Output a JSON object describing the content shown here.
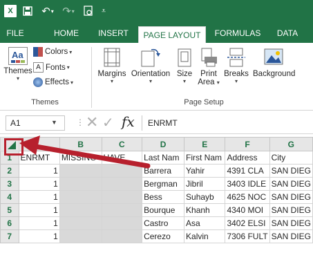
{
  "quick_access": {
    "logo": "X",
    "save_icon": "save-icon",
    "undo_icon": "undo-icon",
    "redo_icon": "redo-icon",
    "print_preview_icon": "print-preview-icon",
    "customize_icon": "customize-icon"
  },
  "tabs": [
    "FILE",
    "HOME",
    "INSERT",
    "PAGE LAYOUT",
    "FORMULAS",
    "DATA"
  ],
  "active_tab": "PAGE LAYOUT",
  "ribbon": {
    "themes_group": {
      "themes_label": "Themes",
      "colors_label": "Colors",
      "fonts_label": "Fonts",
      "effects_label": "Effects",
      "group_label": "Themes",
      "theme_icon_text": "Aa"
    },
    "page_setup_group": {
      "margins_label": "Margins",
      "orientation_label": "Orientation",
      "size_label": "Size",
      "print_area_label_1": "Print",
      "print_area_label_2": "Area",
      "breaks_label": "Breaks",
      "background_label": "Background",
      "group_label": "Page Setup"
    }
  },
  "formula_bar": {
    "name_box": "A1",
    "content": "ENRMT",
    "fx": "fx"
  },
  "columns": [
    "B",
    "C",
    "D",
    "E",
    "F",
    "G"
  ],
  "rows": [
    {
      "num": "1",
      "A": "ENRMT",
      "B": "MISSING",
      "C": "HAVE_",
      "D": "Last Nam",
      "E": "First Nam",
      "F": "Address",
      "G": "City"
    },
    {
      "num": "2",
      "A": "1",
      "B": "",
      "C": "",
      "D": "Barrera",
      "E": "Yahir",
      "F": "4391 CLA",
      "G": "SAN DIEG"
    },
    {
      "num": "3",
      "A": "1",
      "B": "",
      "C": "",
      "D": "Bergman",
      "E": "Jibril",
      "F": "3403 IDLE",
      "G": "SAN DIEG"
    },
    {
      "num": "4",
      "A": "1",
      "B": "",
      "C": "",
      "D": "Bess",
      "E": "Suhayb",
      "F": "4625 NOC",
      "G": "SAN DIEG"
    },
    {
      "num": "5",
      "A": "1",
      "B": "",
      "C": "",
      "D": "Bourque",
      "E": "Khanh",
      "F": "4340 MOI",
      "G": "SAN DIEG"
    },
    {
      "num": "6",
      "A": "1",
      "B": "",
      "C": "",
      "D": "Castro",
      "E": "Asa",
      "F": "3402 ELSI",
      "G": "SAN DIEG"
    },
    {
      "num": "7",
      "A": "1",
      "B": "",
      "C": "",
      "D": "Cerezo",
      "E": "Kalvin",
      "F": "7306 FULT",
      "G": "SAN DIEG"
    }
  ],
  "colors": {
    "excel_green": "#217346",
    "highlight_red": "#b7202d"
  }
}
